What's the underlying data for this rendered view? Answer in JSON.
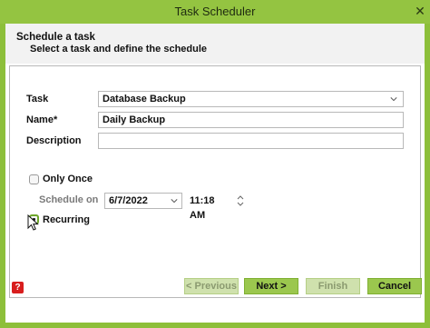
{
  "window": {
    "title": "Task Scheduler",
    "close_glyph": "✕"
  },
  "header": {
    "title": "Schedule a task",
    "subtitle": "Select a task and define the schedule"
  },
  "form": {
    "task_label": "Task",
    "task_value": "Database Backup",
    "name_label": "Name*",
    "name_value": "Daily Backup",
    "description_label": "Description",
    "description_value": "",
    "only_once_label": "Only Once",
    "only_once_selected": false,
    "schedule_on_label": "Schedule on",
    "date_value": "6/7/2022",
    "time_value": "11:18 AM",
    "recurring_label": "Recurring",
    "recurring_selected": true
  },
  "footer": {
    "help_glyph": "?",
    "help_icon": "help-icon",
    "previous_label": "< Previous",
    "next_label": "Next >",
    "finish_label": "Finish",
    "cancel_label": "Cancel"
  },
  "colors": {
    "accent": "#94c441",
    "button": "#9bc74e",
    "button_disabled": "#cfe1ad",
    "help": "#d81e1e"
  }
}
